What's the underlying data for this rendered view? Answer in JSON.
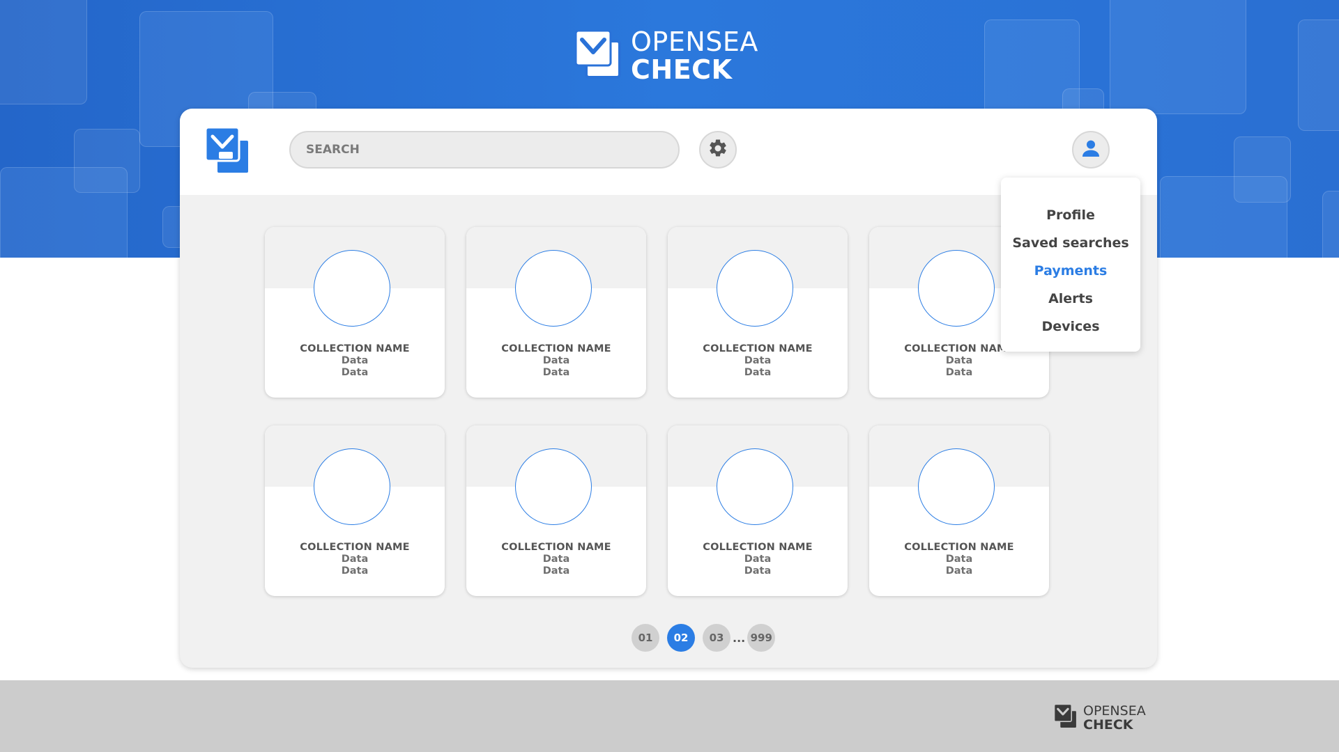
{
  "brand": {
    "line1": "OPENSEA",
    "line2": "CHECK",
    "logo_icon": "check-squares-logo-icon"
  },
  "header": {
    "search": {
      "placeholder": "SEARCH",
      "value": ""
    },
    "settings_icon": "gear-icon",
    "user_icon": "user-icon"
  },
  "user_menu": {
    "items": [
      {
        "label": "Profile",
        "active": false
      },
      {
        "label": "Saved searches",
        "active": false
      },
      {
        "label": "Payments",
        "active": true
      },
      {
        "label": "Alerts",
        "active": false
      },
      {
        "label": "Devices",
        "active": false
      }
    ]
  },
  "collections": [
    {
      "title": "COLLECTION NAME",
      "data1": "Data",
      "data2": "Data"
    },
    {
      "title": "COLLECTION NAME",
      "data1": "Data",
      "data2": "Data"
    },
    {
      "title": "COLLECTION NAME",
      "data1": "Data",
      "data2": "Data"
    },
    {
      "title": "COLLECTION NAME",
      "data1": "Data",
      "data2": "Data"
    },
    {
      "title": "COLLECTION NAME",
      "data1": "Data",
      "data2": "Data"
    },
    {
      "title": "COLLECTION NAME",
      "data1": "Data",
      "data2": "Data"
    },
    {
      "title": "COLLECTION NAME",
      "data1": "Data",
      "data2": "Data"
    },
    {
      "title": "COLLECTION NAME",
      "data1": "Data",
      "data2": "Data"
    }
  ],
  "pagination": {
    "pages": [
      "01",
      "02",
      "03"
    ],
    "current": "02",
    "ellipsis": "...",
    "last": "999"
  },
  "footer": {
    "line1": "OPENSEA",
    "line2": "CHECK"
  },
  "colors": {
    "accent": "#2b7de4",
    "hero": "#2a72d8",
    "panel": "#f1f1f1",
    "footer": "#cccccc"
  }
}
